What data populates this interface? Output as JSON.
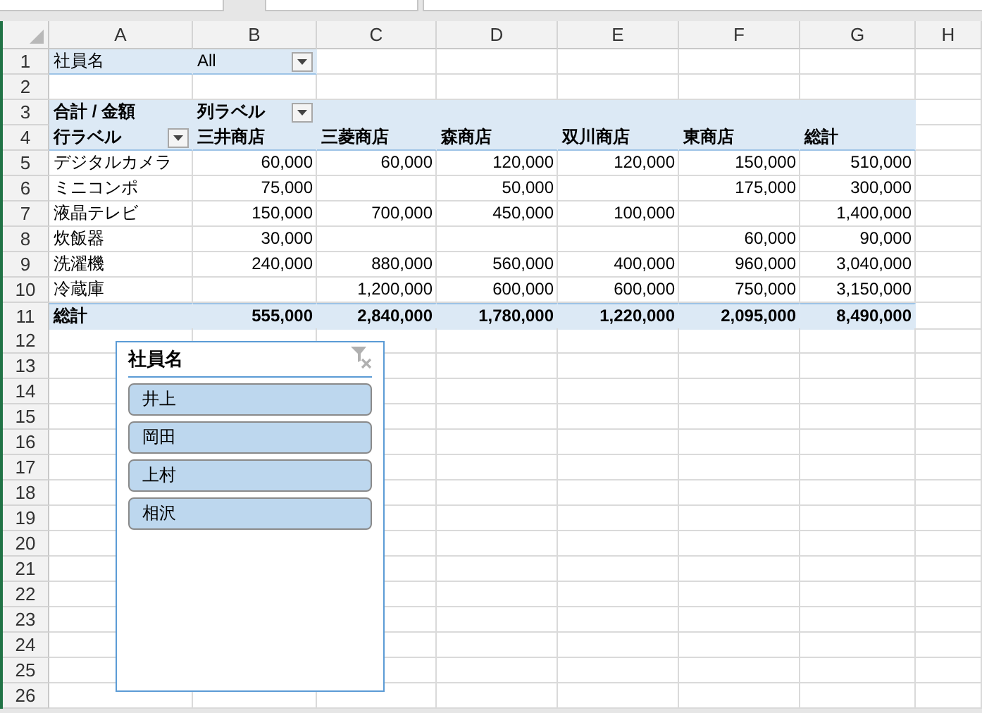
{
  "sheet": {
    "columns": [
      "A",
      "B",
      "C",
      "D",
      "E",
      "F",
      "G",
      "H"
    ],
    "rows": [
      {
        "number": "1",
        "kind": "filter",
        "cells": [
          {
            "text": "社員名",
            "dropdown": false
          },
          {
            "text": "All",
            "dropdown": true
          }
        ]
      },
      {
        "number": "2",
        "kind": "blank",
        "cells": []
      },
      {
        "number": "3",
        "kind": "col_label",
        "cells": [
          {
            "text": "合計 / 金額",
            "dropdown": false
          },
          {
            "text": "列ラベル",
            "dropdown": true
          }
        ]
      },
      {
        "number": "4",
        "kind": "header",
        "cells": [
          {
            "text": "行ラベル",
            "dropdown": true
          },
          {
            "text": "三井商店",
            "dropdown": false
          },
          {
            "text": "三菱商店",
            "dropdown": false
          },
          {
            "text": "森商店",
            "dropdown": false
          },
          {
            "text": "双川商店",
            "dropdown": false
          },
          {
            "text": "東商店",
            "dropdown": false
          },
          {
            "text": "総計",
            "dropdown": false
          }
        ]
      },
      {
        "number": "5",
        "kind": "data",
        "cells": [
          "デジタルカメラ",
          "60,000",
          "60,000",
          "120,000",
          "120,000",
          "150,000",
          "510,000"
        ]
      },
      {
        "number": "6",
        "kind": "data",
        "cells": [
          "ミニコンポ",
          "75,000",
          null,
          "50,000",
          null,
          "175,000",
          "300,000"
        ]
      },
      {
        "number": "7",
        "kind": "data",
        "cells": [
          "液晶テレビ",
          "150,000",
          "700,000",
          "450,000",
          "100,000",
          null,
          "1,400,000"
        ]
      },
      {
        "number": "8",
        "kind": "data",
        "cells": [
          "炊飯器",
          "30,000",
          null,
          null,
          null,
          "60,000",
          "90,000"
        ]
      },
      {
        "number": "9",
        "kind": "data",
        "cells": [
          "洗濯機",
          "240,000",
          "880,000",
          "560,000",
          "400,000",
          "960,000",
          "3,040,000"
        ]
      },
      {
        "number": "10",
        "kind": "data",
        "cells": [
          "冷蔵庫",
          null,
          "1,200,000",
          "600,000",
          "600,000",
          "750,000",
          "3,150,000"
        ]
      },
      {
        "number": "11",
        "kind": "total",
        "cells": [
          "総計",
          "555,000",
          "2,840,000",
          "1,780,000",
          "1,220,000",
          "2,095,000",
          "8,490,000"
        ]
      },
      {
        "number": "12",
        "kind": "blank",
        "cells": []
      },
      {
        "number": "13",
        "kind": "blank",
        "cells": []
      },
      {
        "number": "14",
        "kind": "blank",
        "cells": []
      },
      {
        "number": "15",
        "kind": "blank",
        "cells": []
      },
      {
        "number": "16",
        "kind": "blank",
        "cells": []
      },
      {
        "number": "17",
        "kind": "blank",
        "cells": []
      },
      {
        "number": "18",
        "kind": "blank",
        "cells": []
      },
      {
        "number": "19",
        "kind": "blank",
        "cells": []
      },
      {
        "number": "20",
        "kind": "blank",
        "cells": []
      },
      {
        "number": "21",
        "kind": "blank",
        "cells": []
      },
      {
        "number": "22",
        "kind": "blank",
        "cells": []
      },
      {
        "number": "23",
        "kind": "blank",
        "cells": []
      },
      {
        "number": "24",
        "kind": "blank",
        "cells": []
      },
      {
        "number": "25",
        "kind": "blank",
        "cells": []
      },
      {
        "number": "26",
        "kind": "blank",
        "cells": []
      }
    ]
  },
  "slicer": {
    "title": "社員名",
    "items": [
      {
        "label": "井上",
        "selected": true
      },
      {
        "label": "岡田",
        "selected": true
      },
      {
        "label": "上村",
        "selected": true
      },
      {
        "label": "相沢",
        "selected": true
      }
    ]
  }
}
